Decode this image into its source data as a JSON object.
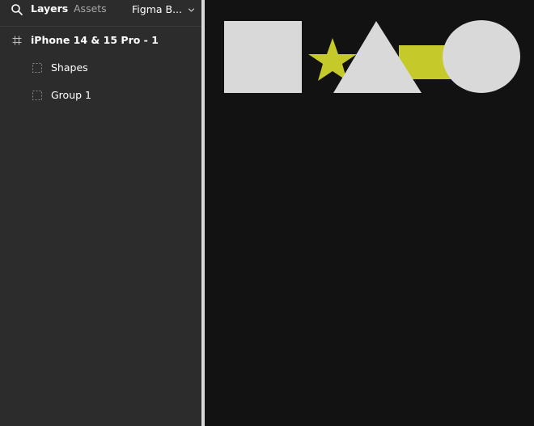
{
  "panel": {
    "tabs": {
      "layers": "Layers",
      "assets": "Assets"
    },
    "file_name": "Figma B...",
    "icons": {
      "search": "search-icon",
      "chevron": "chevron-down-icon",
      "frame": "frame-icon",
      "group": "group-icon"
    }
  },
  "layers": [
    {
      "label": "iPhone 14 & 15 Pro - 1"
    },
    {
      "label": "Shapes"
    },
    {
      "label": "Group 1"
    }
  ],
  "canvas": {
    "colors": {
      "background": "#121212",
      "shape_light": "#d9d9d9",
      "accent": "#c6c92a"
    }
  }
}
